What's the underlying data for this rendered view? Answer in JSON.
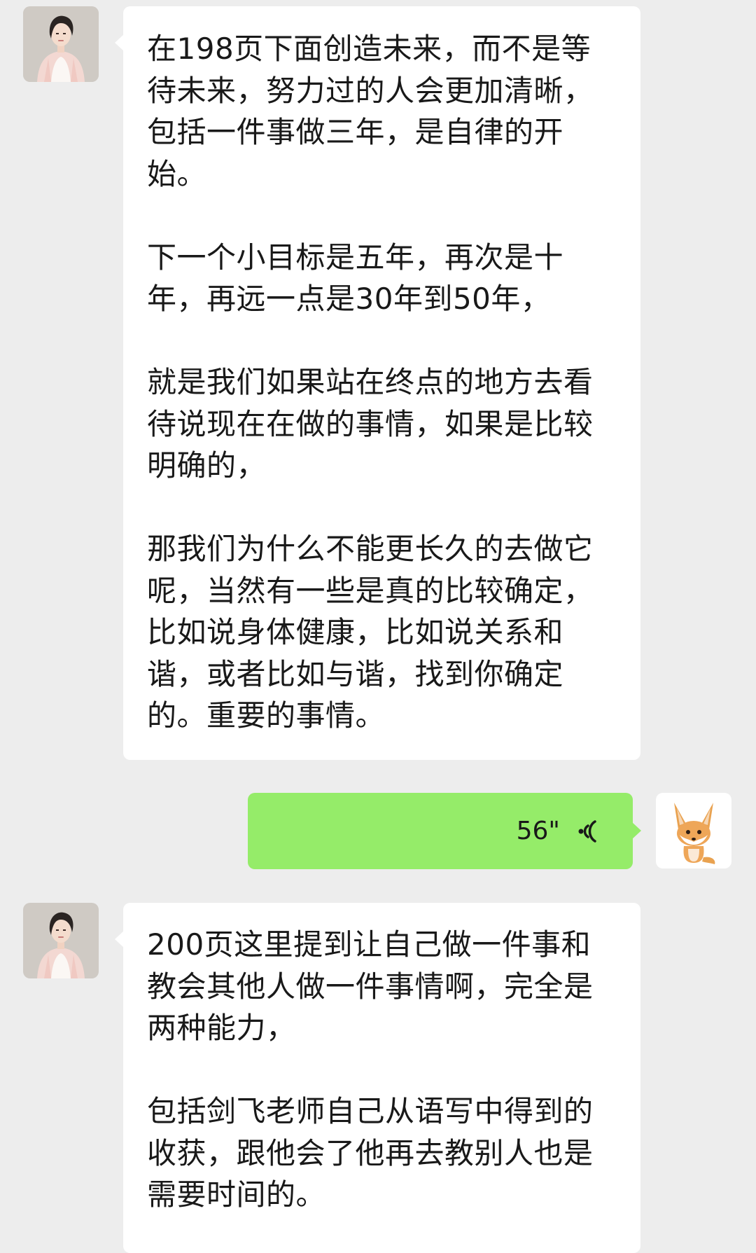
{
  "messages": [
    {
      "sender": "other",
      "paragraphs": [
        "在198页下面创造未来，而不是等\n待未来，努力过的人会更加清晰，\n包括一件事做三年，是自律的开\n始。",
        "下一个小目标是五年，再次是十\n年，再远一点是30年到50年，",
        "就是我们如果站在终点的地方去看\n待说现在在做的事情，如果是比较\n明确的，",
        "那我们为什么不能更长久的去做它\n呢，当然有一些是真的比较确定，\n比如说身体健康，比如说关系和\n谐，或者比如与谐，找到你确定\n的。重要的事情。"
      ]
    },
    {
      "sender": "self",
      "type": "voice",
      "duration": "56\""
    },
    {
      "sender": "other",
      "paragraphs": [
        "200页这里提到让自己做一件事和\n教会其他人做一件事情啊，完全是\n两种能力，",
        "包括剑飞老师自己从语写中得到的\n收获，跟他会了他再去教别人也是\n需要时间的。"
      ]
    }
  ],
  "colors": {
    "background": "#ededed",
    "incoming_bubble": "#ffffff",
    "outgoing_bubble": "#95ec69",
    "text": "#191919"
  },
  "icons": {
    "other_avatar": "woman-portrait-avatar",
    "self_avatar": "fox-avatar",
    "voice": "voice-wave-icon"
  }
}
